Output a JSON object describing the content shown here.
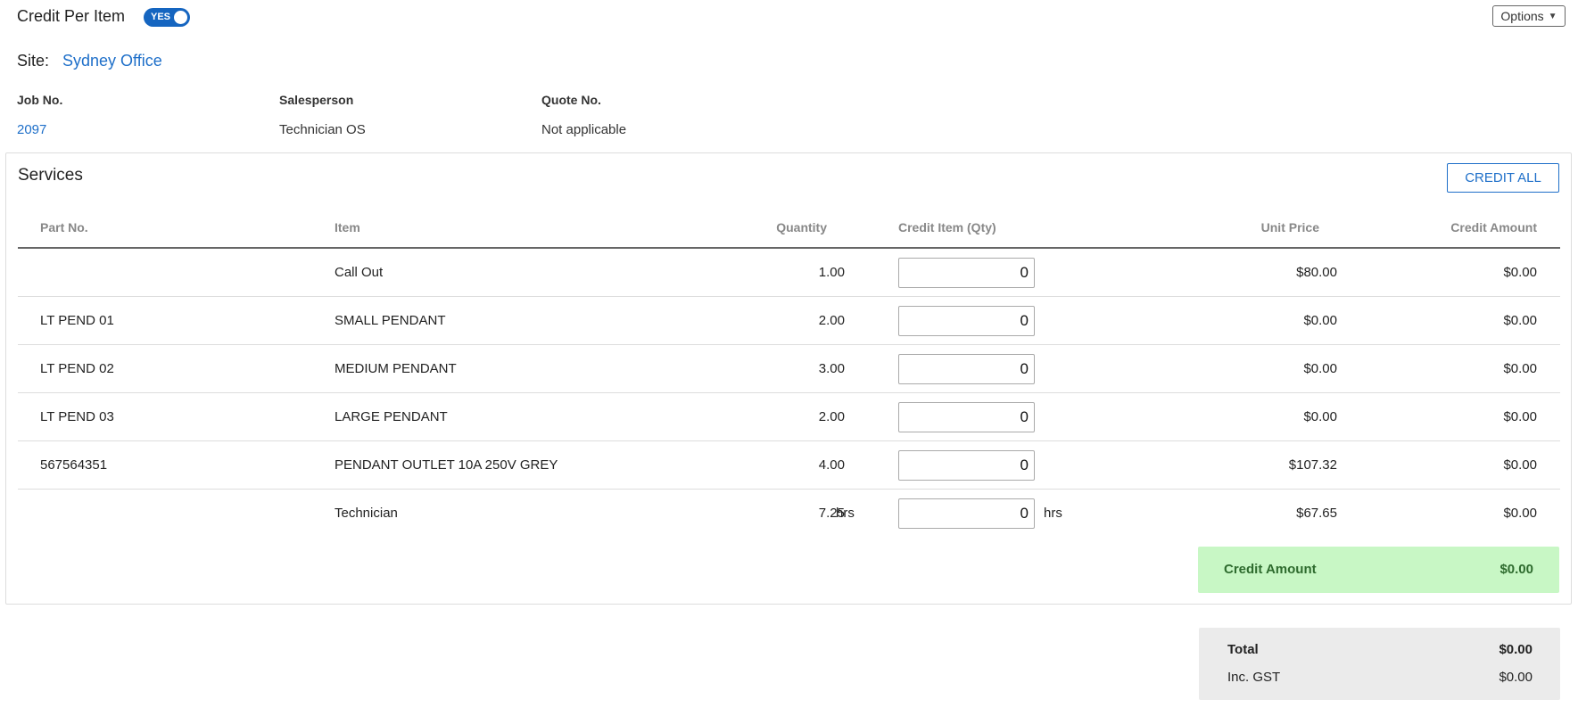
{
  "header": {
    "title": "Credit Per Item",
    "toggle_label": "YES",
    "options_label": "Options"
  },
  "site": {
    "label": "Site:",
    "value": "Sydney Office"
  },
  "meta": {
    "job_label": "Job No.",
    "job_value": "2097",
    "salesperson_label": "Salesperson",
    "salesperson_value": "Technician OS",
    "quote_label": "Quote No.",
    "quote_value": "Not applicable"
  },
  "services": {
    "title": "Services",
    "credit_all_label": "CREDIT ALL",
    "columns": {
      "part": "Part No.",
      "item": "Item",
      "quantity": "Quantity",
      "credit_qty": "Credit Item (Qty)",
      "unit_price": "Unit Price",
      "credit_amount": "Credit Amount"
    },
    "rows": [
      {
        "part": "",
        "item": "Call Out",
        "quantity": "1.00",
        "unit": "",
        "credit_qty": "0",
        "unit2": "",
        "unit_price": "$80.00",
        "credit_amount": "$0.00"
      },
      {
        "part": "LT PEND 01",
        "item": "SMALL PENDANT",
        "quantity": "2.00",
        "unit": "",
        "credit_qty": "0",
        "unit2": "",
        "unit_price": "$0.00",
        "credit_amount": "$0.00"
      },
      {
        "part": "LT PEND 02",
        "item": "MEDIUM PENDANT",
        "quantity": "3.00",
        "unit": "",
        "credit_qty": "0",
        "unit2": "",
        "unit_price": "$0.00",
        "credit_amount": "$0.00"
      },
      {
        "part": "LT PEND 03",
        "item": "LARGE PENDANT",
        "quantity": "2.00",
        "unit": "",
        "credit_qty": "0",
        "unit2": "",
        "unit_price": "$0.00",
        "credit_amount": "$0.00"
      },
      {
        "part": "567564351",
        "item": "PENDANT OUTLET 10A 250V GREY",
        "quantity": "4.00",
        "unit": "",
        "credit_qty": "0",
        "unit2": "",
        "unit_price": "$107.32",
        "credit_amount": "$0.00"
      },
      {
        "part": "",
        "item": "Technician",
        "quantity": "7.25",
        "unit": "hrs",
        "credit_qty": "0",
        "unit2": "hrs",
        "unit_price": "$67.65",
        "credit_amount": "$0.00"
      }
    ],
    "credit_summary_label": "Credit Amount",
    "credit_summary_value": "$0.00"
  },
  "totals": {
    "total_label": "Total",
    "total_value": "$0.00",
    "gst_label": "Inc. GST",
    "gst_value": "$0.00"
  },
  "colors": {
    "accent": "#1e6fc9",
    "toggle": "#1565c0",
    "credit_box": "#c8f7c5",
    "totals_box": "#ebebeb"
  }
}
